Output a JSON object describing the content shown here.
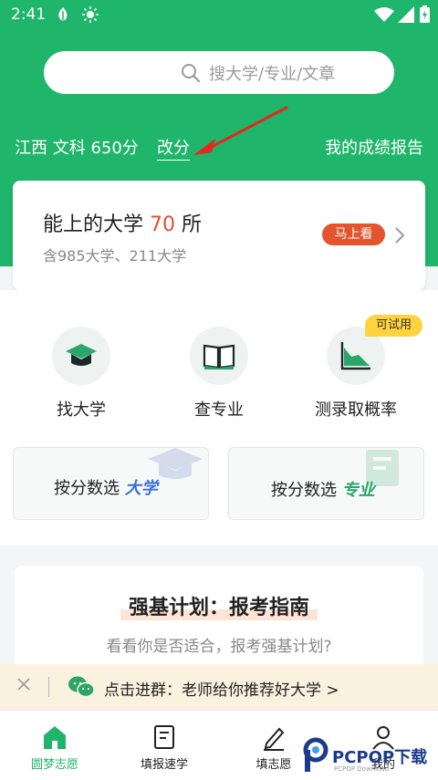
{
  "status_bar": {
    "time": "2:41"
  },
  "search": {
    "placeholder": "搜大学/专业/文章"
  },
  "profile": {
    "score_text": "江西 文科 650分",
    "modify_label": "改分",
    "report_label": "我的成绩报告"
  },
  "summary_card": {
    "title_prefix": "能上的大学",
    "count": "70",
    "title_suffix": "所",
    "subtitle": "含985大学、211大学",
    "button_label": "马上看"
  },
  "features": [
    {
      "label": "找大学",
      "icon": "graduation-cap-icon"
    },
    {
      "label": "查专业",
      "icon": "open-book-icon"
    },
    {
      "label": "测录取概率",
      "icon": "area-chart-icon",
      "tag": "可试用"
    }
  ],
  "select_boxes": [
    {
      "prefix": "按分数选",
      "highlight": "大学"
    },
    {
      "prefix": "按分数选",
      "highlight": "专业"
    }
  ],
  "article": {
    "title": "强基计划：报考指南",
    "subtitle": "看看你是否适合，报考强基计划?"
  },
  "banner": {
    "text": "点击进群：老师给你推荐好大学 >"
  },
  "tabs": [
    {
      "label": "圆梦志愿",
      "icon": "home-icon",
      "active": true
    },
    {
      "label": "填报速学",
      "icon": "document-icon",
      "active": false
    },
    {
      "label": "填志愿",
      "icon": "pen-icon",
      "active": false
    },
    {
      "label": "我的",
      "icon": "user-icon",
      "active": false
    }
  ],
  "watermark": {
    "brand": "PCPOP下载",
    "small": "PCPOP Download"
  },
  "colors": {
    "primary": "#1fb56b",
    "accent": "#e2552e",
    "tag": "#ffd33d"
  }
}
